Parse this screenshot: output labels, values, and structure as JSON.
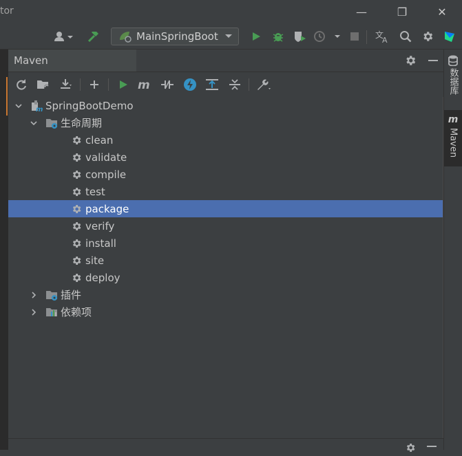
{
  "window": {
    "title_fragment": "tor",
    "minimize": "—",
    "restore": "❐",
    "close": "✕"
  },
  "toolbar": {
    "run_config": "MainSpringBoot"
  },
  "maven": {
    "title": "Maven"
  },
  "tree": [
    {
      "label": "SpringBootDemo",
      "level": 0,
      "expanded": true,
      "kind": "project"
    },
    {
      "label": "生命周期",
      "level": 1,
      "expanded": true,
      "kind": "folder"
    },
    {
      "label": "clean",
      "level": 2,
      "kind": "goal"
    },
    {
      "label": "validate",
      "level": 2,
      "kind": "goal"
    },
    {
      "label": "compile",
      "level": 2,
      "kind": "goal"
    },
    {
      "label": "test",
      "level": 2,
      "kind": "goal"
    },
    {
      "label": "package",
      "level": 2,
      "kind": "goal",
      "selected": true
    },
    {
      "label": "verify",
      "level": 2,
      "kind": "goal"
    },
    {
      "label": "install",
      "level": 2,
      "kind": "goal"
    },
    {
      "label": "site",
      "level": 2,
      "kind": "goal"
    },
    {
      "label": "deploy",
      "level": 2,
      "kind": "goal"
    },
    {
      "label": "插件",
      "level": 1,
      "expanded": false,
      "kind": "folder"
    },
    {
      "label": "依赖项",
      "level": 1,
      "expanded": false,
      "kind": "deps"
    }
  ],
  "right_panel": {
    "tab1": "数据库",
    "tab2": "Maven",
    "tab2_icon": "m"
  },
  "colors": {
    "selection": "#4b6eaf",
    "run": "#499c54",
    "accent": "#cc7832"
  }
}
